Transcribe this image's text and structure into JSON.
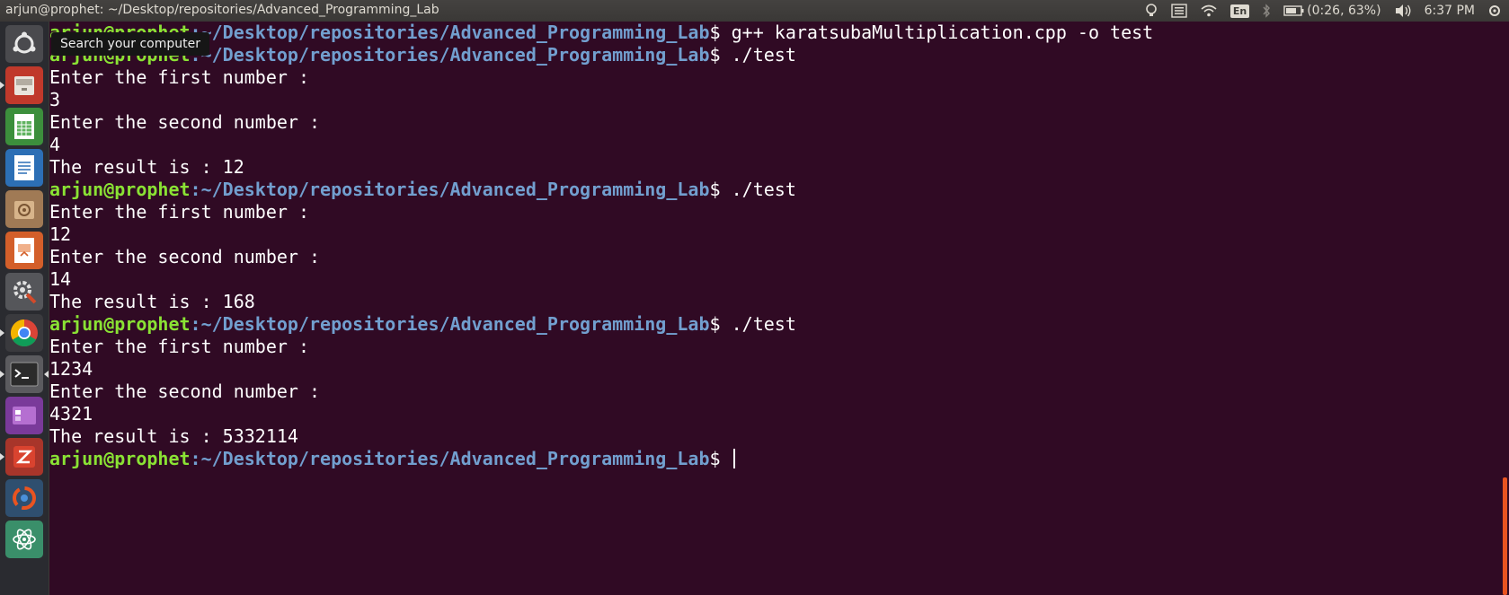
{
  "window": {
    "title": "arjun@prophet: ~/Desktop/repositories/Advanced_Programming_Lab"
  },
  "panel": {
    "battery_text": "(0:26, 63%)",
    "clock": "6:37 PM",
    "keyboard_lang": "En",
    "icons": [
      "lightbulb-icon",
      "menu-list-icon",
      "wifi-icon",
      "keyboard-icon",
      "bluetooth-icon",
      "battery-icon",
      "volume-icon"
    ]
  },
  "launcher": {
    "tooltip": "Search your computer",
    "items": [
      {
        "name": "dash-home",
        "icon": "ubuntu-logo-icon"
      },
      {
        "name": "files",
        "icon": "file-cabinet-icon"
      },
      {
        "name": "calc",
        "icon": "spreadsheet-icon"
      },
      {
        "name": "writer",
        "icon": "document-icon"
      },
      {
        "name": "archive",
        "icon": "archive-box-icon"
      },
      {
        "name": "impress",
        "icon": "presentation-icon"
      },
      {
        "name": "system-settings",
        "icon": "gear-wrench-icon"
      },
      {
        "name": "chrome",
        "icon": "chrome-icon"
      },
      {
        "name": "terminal",
        "icon": "terminal-icon"
      },
      {
        "name": "workspaces",
        "icon": "workspace-icon"
      },
      {
        "name": "zotero",
        "icon": "z-app-icon"
      },
      {
        "name": "software-updater",
        "icon": "update-icon"
      },
      {
        "name": "atom",
        "icon": "atom-icon"
      }
    ]
  },
  "terminal": {
    "prompt_user": "arjun@prophet",
    "prompt_path": ":~/Desktop/repositories/Advanced_Programming_Lab",
    "prompt_suffix": "$ ",
    "lines": [
      {
        "type": "prompt",
        "cmd": "g++ karatsubaMultiplication.cpp -o test"
      },
      {
        "type": "prompt",
        "cmd": "./test"
      },
      {
        "type": "out",
        "text": "Enter the first number :"
      },
      {
        "type": "out",
        "text": "3"
      },
      {
        "type": "out",
        "text": "Enter the second number :"
      },
      {
        "type": "out",
        "text": "4"
      },
      {
        "type": "out",
        "text": "The result is : 12"
      },
      {
        "type": "prompt",
        "cmd": "./test"
      },
      {
        "type": "out",
        "text": "Enter the first number :"
      },
      {
        "type": "out",
        "text": "12"
      },
      {
        "type": "out",
        "text": "Enter the second number :"
      },
      {
        "type": "out",
        "text": "14"
      },
      {
        "type": "out",
        "text": "The result is : 168"
      },
      {
        "type": "prompt",
        "cmd": "./test"
      },
      {
        "type": "out",
        "text": "Enter the first number :"
      },
      {
        "type": "out",
        "text": "1234"
      },
      {
        "type": "out",
        "text": "Enter the second number :"
      },
      {
        "type": "out",
        "text": "4321"
      },
      {
        "type": "out",
        "text": "The result is : 5332114"
      },
      {
        "type": "prompt",
        "cmd": "",
        "cursor": true
      }
    ]
  },
  "colors": {
    "terminal_bg": "#300a24",
    "prompt_user": "#8ae234",
    "prompt_path": "#729fcf",
    "scroll_thumb": "#e95420"
  }
}
